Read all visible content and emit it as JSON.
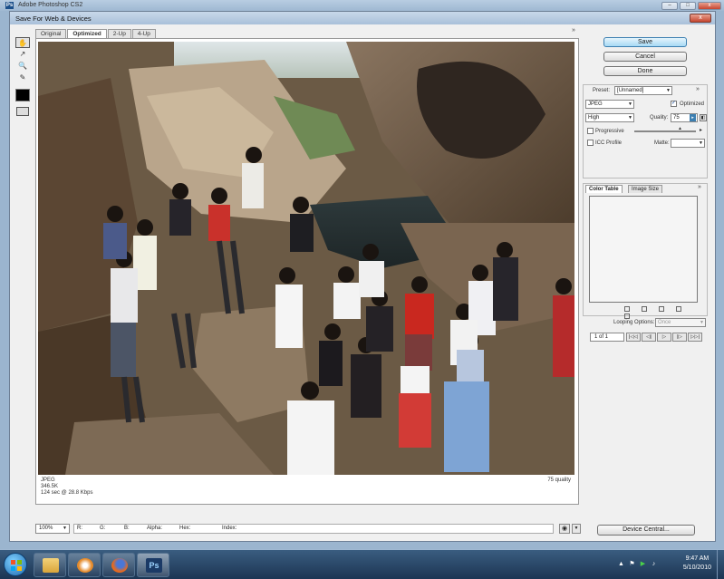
{
  "app": {
    "title": "Adobe Photoshop CS2"
  },
  "dialog": {
    "title": "Save For Web & Devices",
    "close_symbol": "x"
  },
  "tabs": [
    {
      "label": "Original"
    },
    {
      "label": "Optimized"
    },
    {
      "label": "2-Up"
    },
    {
      "label": "4-Up"
    }
  ],
  "preview": {
    "format": "JPEG",
    "file_size": "346.5K",
    "download_time": "124 sec @ 28.8 Kbps",
    "quality_note": "75 quality"
  },
  "buttons": {
    "save": "Save",
    "cancel": "Cancel",
    "done": "Done",
    "device_central": "Device Central..."
  },
  "settings": {
    "preset_label": "Preset:",
    "preset_value": "[Unnamed]",
    "format_value": "JPEG",
    "optimized_label": "Optimized",
    "optimized_checked": true,
    "compression_value": "High",
    "quality_label": "Quality:",
    "quality_value": "75",
    "progressive_label": "Progressive",
    "icc_label": "ICC Profile",
    "matte_label": "Matte:"
  },
  "color_table": {
    "tab_color": "Color Table",
    "tab_size": "Image Size"
  },
  "animation": {
    "looping_label": "Looping Options:",
    "looping_value": "Once",
    "frame_count": "1 of 1"
  },
  "status": {
    "zoom": "100%",
    "r": "R:",
    "g": "G:",
    "b": "B:",
    "alpha": "Alpha:",
    "hex": "Hex:",
    "index": "Index:"
  },
  "taskbar": {
    "time": "9:47 AM",
    "date": "5/10/2010",
    "ps_label": "Ps"
  },
  "colors": {
    "taskbar": "#1c3553",
    "save_button": "#a7d9f5",
    "dialog_bg": "#f0f0f0"
  }
}
